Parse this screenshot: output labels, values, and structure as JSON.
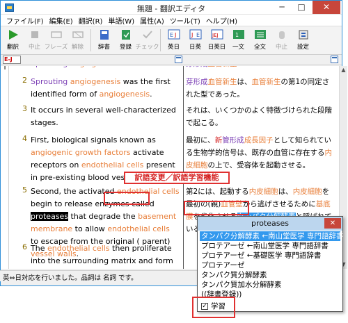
{
  "window": {
    "title": "無題 - 翻訳エディタ",
    "minimize": "─",
    "maximize": "□",
    "close": "✕"
  },
  "menu": [
    "ファイル(F)",
    "編集(E)",
    "翻訳(R)",
    "単語(W)",
    "属性(A)",
    "ツール(T)",
    "ヘルプ(H)"
  ],
  "toolbar": {
    "translate": "翻訳",
    "stop": "中止",
    "phrase": "フレーズ",
    "cancel_translation": "解除",
    "dictionary": "辞書",
    "register": "登録",
    "check": "チェック",
    "en_ja": "英日",
    "ja_en": "日英",
    "ja_en_sub": "日英日",
    "bilingual": "一文",
    "full_text": "全文",
    "interrupt": "中止",
    "settings": "設定"
  },
  "direction_selector": "E-J",
  "editor": {
    "gutter_mark": "T",
    "rows": [
      {
        "num": "1",
        "src": [
          {
            "t": "Sprouting ",
            "c": "pu"
          },
          {
            "t": "angiogenesis",
            "c": "or"
          }
        ],
        "tgt": [
          {
            "t": "芽形成",
            "c": "pu"
          },
          {
            "t": "血管新生",
            "c": "or"
          }
        ]
      },
      {
        "num": "2",
        "src": [
          {
            "t": "Sprouting ",
            "c": "pu"
          },
          {
            "t": "angiogenesis",
            "c": "or"
          },
          {
            "t": " was the first identified form of ",
            "c": ""
          },
          {
            "t": "angiogenesis",
            "c": "or"
          },
          {
            "t": ".",
            "c": ""
          }
        ],
        "tgt": [
          {
            "t": "芽形成",
            "c": "pu"
          },
          {
            "t": "血管新生",
            "c": "or"
          },
          {
            "t": "は、",
            "c": ""
          },
          {
            "t": "血管新生",
            "c": "or"
          },
          {
            "t": "の第1の同定された型であった。",
            "c": ""
          }
        ]
      },
      {
        "num": "3",
        "src": [
          {
            "t": "It occurs in several well-characterized stages.",
            "c": ""
          }
        ],
        "tgt": [
          {
            "t": "それは、いくつかのよく特徴づけられた段階で起こる。",
            "c": ""
          }
        ]
      },
      {
        "num": "4",
        "src": [
          {
            "t": "First, biological signals known as ",
            "c": ""
          },
          {
            "t": "angiogenic growth factors",
            "c": "or"
          },
          {
            "t": " activate receptors on ",
            "c": ""
          },
          {
            "t": "endothelial cells",
            "c": "or"
          },
          {
            "t": " present in pre-existing blood vessels.",
            "c": ""
          }
        ],
        "tgt": [
          {
            "t": "最初に、",
            "c": ""
          },
          {
            "t": "新",
            "c": "rd"
          },
          {
            "t": "管形成",
            "c": "pu"
          },
          {
            "t": "成長因子",
            "c": "or"
          },
          {
            "t": "として知られている生物学的信号は、既存の血管に存在する",
            "c": ""
          },
          {
            "t": "内皮細胞",
            "c": "or"
          },
          {
            "t": "の上で、受容体を起動させる。",
            "c": ""
          }
        ]
      },
      {
        "num": "5",
        "src": [
          {
            "t": "Second, the activated ",
            "c": ""
          },
          {
            "t": "endothelial cells",
            "c": "or"
          },
          {
            "t": " begin to release enzymes called ",
            "c": ""
          },
          {
            "t": "proteases",
            "c": "hl-black"
          },
          {
            "t": " that degrade the ",
            "c": ""
          },
          {
            "t": "basement membrane",
            "c": "or"
          },
          {
            "t": " to allow ",
            "c": ""
          },
          {
            "t": "endothelial cells",
            "c": "or"
          },
          {
            "t": " to escape from the original ( parent) ",
            "c": ""
          },
          {
            "t": "vessel walls",
            "c": "or"
          },
          {
            "t": ".",
            "c": ""
          }
        ],
        "tgt": [
          {
            "t": "第2には、起動する",
            "c": ""
          },
          {
            "t": "内皮細胞",
            "c": "or"
          },
          {
            "t": "は、",
            "c": ""
          },
          {
            "t": "内皮細胞",
            "c": "or"
          },
          {
            "t": "を最初の(親)",
            "c": ""
          },
          {
            "t": "血管壁",
            "c": "or"
          },
          {
            "t": "から逃げさせるために",
            "c": ""
          },
          {
            "t": "基底膜",
            "c": "or"
          },
          {
            "t": "を劣化させる",
            "c": ""
          },
          {
            "t": "タンパク分解酵素",
            "c": "hl-blue"
          },
          {
            "t": "と呼ばれている酵素を放出し始める。",
            "c": ""
          }
        ]
      },
      {
        "num": "6",
        "src": [
          {
            "t": "The ",
            "c": ""
          },
          {
            "t": "endothelial cells",
            "c": "or"
          },
          {
            "t": " then proliferate into the surrounding matrix and form solid sprouts",
            "c": ""
          }
        ],
        "tgt": []
      }
    ]
  },
  "callout": "訳語変更／訳語学習機能",
  "popup": {
    "title": "proteases",
    "close": "✕",
    "candidates": [
      "タンパク分解酵素 ←南山堂医学 専門語辞書",
      "プロテアーゼ ←南山堂医学 専門語辞書",
      "プロテアーゼ ←基礎医学 専門語辞書",
      "プロテアーゼ",
      "タンパク質分解酵素",
      "タンパク質加水分解酵素",
      "((辞書登録))"
    ],
    "selected_index": 0,
    "learn_label": "学習",
    "learn_checked": "✓"
  },
  "status": "英⇔日対応を行いました。品詞は 名詞 です。",
  "colors": {
    "orange": "#e87f3a",
    "purple": "#7b3fb5",
    "red": "#d42424",
    "highlight_blue": "#3399ee"
  }
}
